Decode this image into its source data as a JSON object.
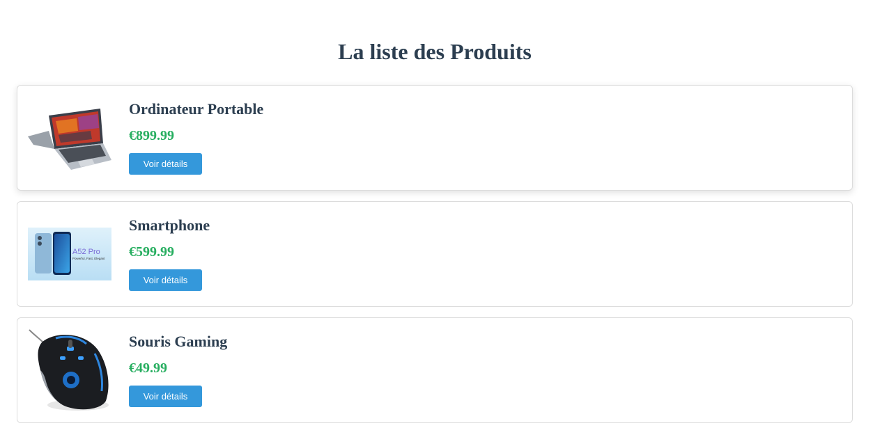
{
  "page": {
    "title": "La liste des Produits"
  },
  "products": [
    {
      "name": "Ordinateur Portable",
      "price": "€899.99",
      "button_label": "Voir détails",
      "image": "laptop-image",
      "image_text": ""
    },
    {
      "name": "Smartphone",
      "price": "€599.99",
      "button_label": "Voir détails",
      "image": "smartphone-image",
      "image_text": "A52 Pro",
      "image_tagline": "Powerful, Fast, Elegant"
    },
    {
      "name": "Souris Gaming",
      "price": "€49.99",
      "button_label": "Voir détails",
      "image": "gaming-mouse-image",
      "image_text": ""
    }
  ],
  "colors": {
    "heading": "#2c3e50",
    "price": "#27ae60",
    "button": "#3498db",
    "card_border": "#dcdcdc"
  }
}
